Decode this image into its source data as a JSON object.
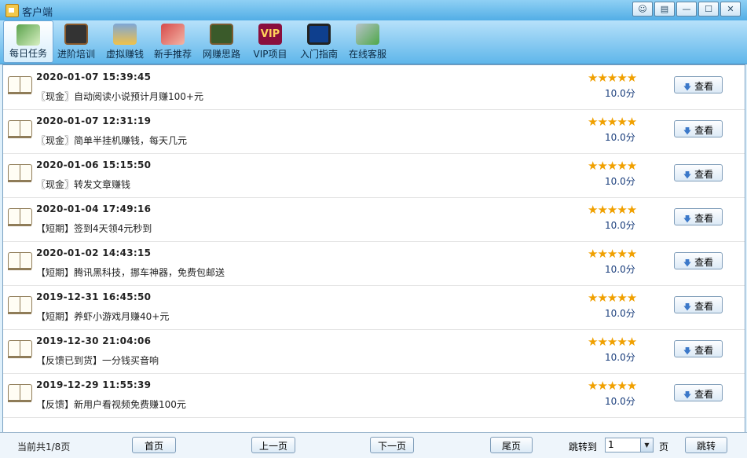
{
  "window": {
    "title": "客户端",
    "buttons": [
      "☺",
      "▤",
      "—",
      "☐",
      "✕"
    ]
  },
  "toolbar": [
    {
      "label": "每日任务",
      "icon": "daily-task-icon",
      "active": true
    },
    {
      "label": "进阶培训",
      "icon": "blackboard-icon"
    },
    {
      "label": "虚拟赚钱",
      "icon": "bank-icon"
    },
    {
      "label": "新手推荐",
      "icon": "hand-money-icon"
    },
    {
      "label": "网赚思路",
      "icon": "board-person-icon"
    },
    {
      "label": "VIP项目",
      "icon": "vip-icon",
      "icon_text": "VIP"
    },
    {
      "label": "入门指南",
      "icon": "monitor-icon"
    },
    {
      "label": "在线客服",
      "icon": "service-disc-icon"
    }
  ],
  "rows": [
    {
      "date": "2020-01-07 15:39:45",
      "title": "〖现金〗自动阅读小说预计月赚100+元",
      "stars": "★★★★★",
      "score": "10.0分",
      "btn": "查看"
    },
    {
      "date": "2020-01-07 12:31:19",
      "title": "〖现金〗简单半挂机赚钱，每天几元",
      "stars": "★★★★★",
      "score": "10.0分",
      "btn": "查看"
    },
    {
      "date": "2020-01-06 15:15:50",
      "title": "〖现金〗转发文章赚钱",
      "stars": "★★★★★",
      "score": "10.0分",
      "btn": "查看"
    },
    {
      "date": "2020-01-04 17:49:16",
      "title": "【短期】签到4天领4元秒到",
      "stars": "★★★★★",
      "score": "10.0分",
      "btn": "查看"
    },
    {
      "date": "2020-01-02 14:43:15",
      "title": "【短期】腾讯黑科技，挪车神器，免费包邮送",
      "stars": "★★★★★",
      "score": "10.0分",
      "btn": "查看"
    },
    {
      "date": "2019-12-31 16:45:50",
      "title": "【短期】养虾小游戏月赚40+元",
      "stars": "★★★★★",
      "score": "10.0分",
      "btn": "查看"
    },
    {
      "date": "2019-12-30 21:04:06",
      "title": "【反馈已到货】一分钱买音响",
      "stars": "★★★★★",
      "score": "10.0分",
      "btn": "查看"
    },
    {
      "date": "2019-12-29 11:55:39",
      "title": "【反馈】新用户看视频免费赚100元",
      "stars": "★★★★★",
      "score": "10.0分",
      "btn": "查看"
    }
  ],
  "footer": {
    "page_info": "当前共1/8页",
    "first": "首页",
    "prev": "上一页",
    "next": "下一页",
    "last": "尾页",
    "jump_label": "跳转到",
    "page_value": "1",
    "page_unit": "页",
    "jump": "跳转"
  },
  "icons": {
    "view": "download-arrow-icon",
    "dropdown": "chevron-down-icon",
    "row": "book-icon"
  }
}
